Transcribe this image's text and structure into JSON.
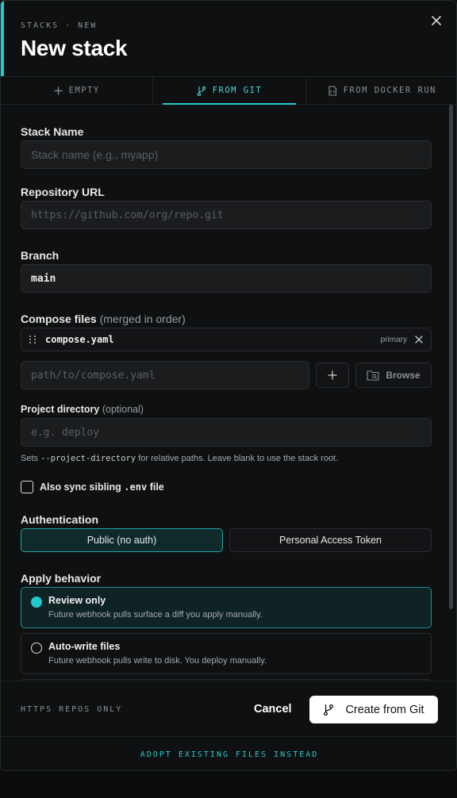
{
  "header": {
    "breadcrumb": "STACKS · NEW",
    "title": "New stack"
  },
  "tabs": [
    {
      "label": "EMPTY",
      "icon": "plus-icon",
      "active": false
    },
    {
      "label": "FROM GIT",
      "icon": "git-branch-icon",
      "active": true
    },
    {
      "label": "FROM DOCKER RUN",
      "icon": "docker-run-icon",
      "active": false
    }
  ],
  "form": {
    "stack_name": {
      "label": "Stack Name",
      "placeholder": "Stack name (e.g., myapp)",
      "value": ""
    },
    "repo_url": {
      "label": "Repository URL",
      "placeholder": "https://github.com/org/repo.git",
      "value": ""
    },
    "branch": {
      "label": "Branch",
      "value": "main"
    },
    "compose_files": {
      "label": "Compose files",
      "label_suffix": "(merged in order)",
      "items": [
        {
          "name": "compose.yaml",
          "tag": "primary"
        }
      ],
      "add_placeholder": "path/to/compose.yaml",
      "browse_label": "Browse"
    },
    "project_directory": {
      "label": "Project directory",
      "label_suffix": "(optional)",
      "placeholder": "e.g. deploy",
      "hint_prefix": "Sets",
      "hint_code": "--project-directory",
      "hint_suffix": "for relative paths. Leave blank to use the stack root."
    },
    "sync_env": {
      "label_prefix": "Also sync sibling",
      "label_code": ".env",
      "label_suffix": "file",
      "checked": false
    },
    "authentication": {
      "label": "Authentication",
      "options": [
        {
          "label": "Public (no auth)",
          "active": true
        },
        {
          "label": "Personal Access Token",
          "active": false
        }
      ]
    },
    "apply_behavior": {
      "label": "Apply behavior",
      "options": [
        {
          "title": "Review only",
          "description": "Future webhook pulls surface a diff you apply manually.",
          "selected": true
        },
        {
          "title": "Auto-write files",
          "description": "Future webhook pulls write to disk. You deploy manually.",
          "selected": false
        }
      ]
    }
  },
  "footer": {
    "note": "HTTPS REPOS ONLY",
    "cancel_label": "Cancel",
    "create_label": "Create from Git"
  },
  "adopt_label": "ADOPT EXISTING FILES INSTEAD",
  "colors": {
    "accent": "#22c9cc",
    "background": "#0e1011",
    "input_bg": "#1a1c1e"
  }
}
